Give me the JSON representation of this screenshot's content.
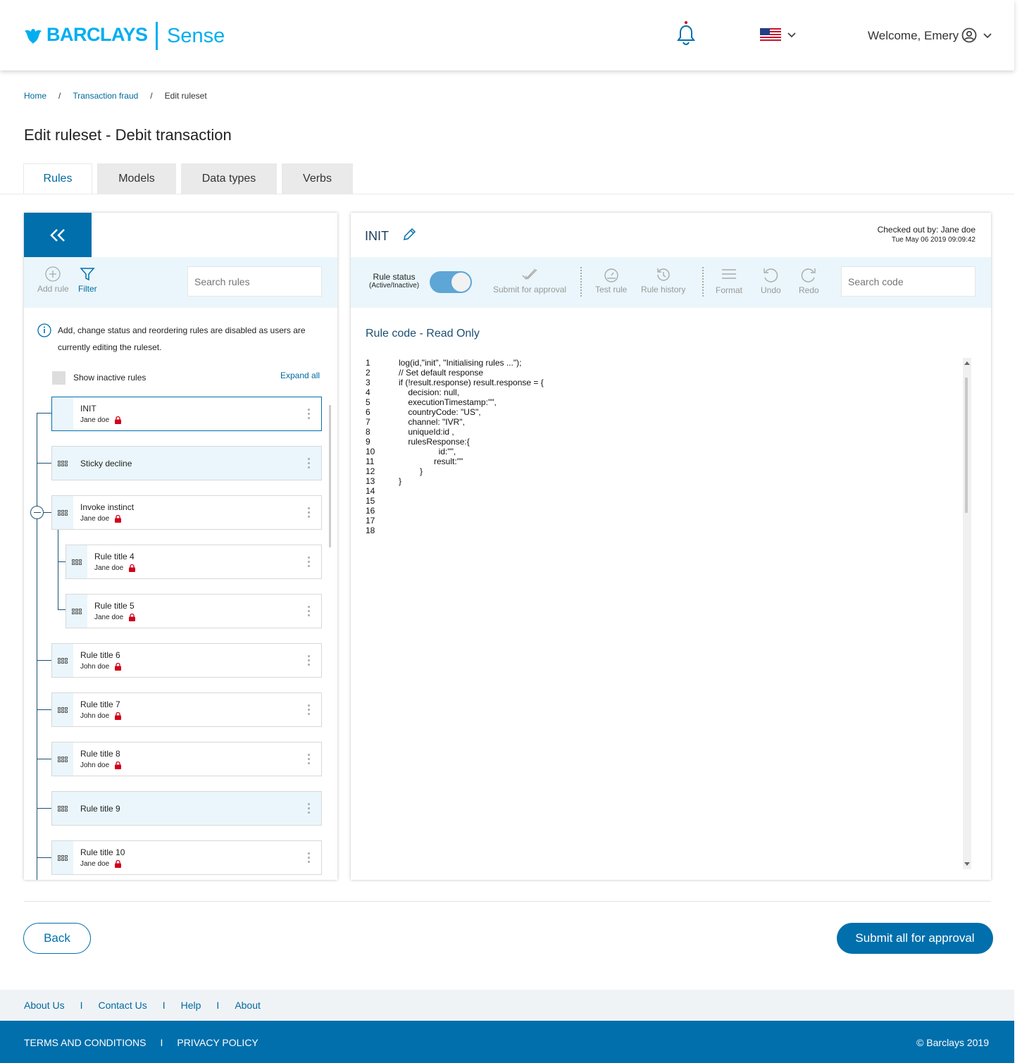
{
  "header": {
    "logo_text": "BARCLAYS",
    "app_name": "Sense",
    "welcome": "Welcome, Emery"
  },
  "breadcrumb": {
    "home": "Home",
    "section": "Transaction fraud",
    "current": "Edit ruleset",
    "separator": "/"
  },
  "page_title": "Edit ruleset - Debit transaction",
  "tabs": [
    {
      "label": "Rules"
    },
    {
      "label": "Models"
    },
    {
      "label": "Data types"
    },
    {
      "label": "Verbs"
    }
  ],
  "left_panel": {
    "add_rule": "Add rule",
    "filter": "Filter",
    "search_placeholder": "Search rules",
    "info_message": "Add, change status and reordering rules are disabled as users are currently editing the ruleset.",
    "show_inactive": "Show inactive rules",
    "expand_all": "Expand all",
    "rules": [
      {
        "name": "INIT",
        "owner": "Jane doe"
      },
      {
        "name": "Sticky decline",
        "owner": ""
      },
      {
        "name": "Invoke instinct",
        "owner": "Jane doe"
      },
      {
        "name": "Rule title 4",
        "owner": "Jane doe"
      },
      {
        "name": "Rule title 5",
        "owner": "Jane doe"
      },
      {
        "name": "Rule title 6",
        "owner": "John doe"
      },
      {
        "name": "Rule title 7",
        "owner": "John doe"
      },
      {
        "name": "Rule title 8",
        "owner": "John doe"
      },
      {
        "name": "Rule title 9",
        "owner": ""
      },
      {
        "name": "Rule title 10",
        "owner": "Jane doe"
      }
    ]
  },
  "right_panel": {
    "title": "INIT",
    "checked_out": "Checked out by: Jane doe",
    "timestamp": "Tue May 06 2019 09:09:42",
    "rule_status": "Rule status",
    "rule_status_sub": "(Active/Inactive)",
    "toolbar": {
      "submit": "Submit for approval",
      "test": "Test rule",
      "history": "Rule history",
      "format": "Format",
      "undo": "Undo",
      "redo": "Redo"
    },
    "search_placeholder": "Search code",
    "code_title": "Rule code - Read Only",
    "code_lines": [
      "log(id,\"init\", \"Initialising rules ...\");",
      "// Set default response",
      "if (!result.response) result.response = {",
      "    decision: null,",
      "    executionTimestamp:\"\",",
      "    countryCode: \"US\",",
      "    channel: \"IVR\",",
      "    uniqueId:id ,",
      "    rulesResponse:{",
      "                 id:\"\",",
      "               result:\"\"",
      "         }",
      "}",
      "",
      "",
      "",
      "",
      ""
    ]
  },
  "buttons": {
    "back": "Back",
    "submit_all": "Submit all for approval"
  },
  "footer": {
    "links": [
      "About Us",
      "Contact Us",
      "Help",
      "About"
    ],
    "separator": "I",
    "legal": [
      "TERMS AND CONDITIONS",
      "PRIVACY POLICY"
    ],
    "copyright": "© Barclays 2019"
  },
  "colors": {
    "brand": "#00aeef",
    "primary": "#006fac",
    "lock": "#d0021b"
  }
}
